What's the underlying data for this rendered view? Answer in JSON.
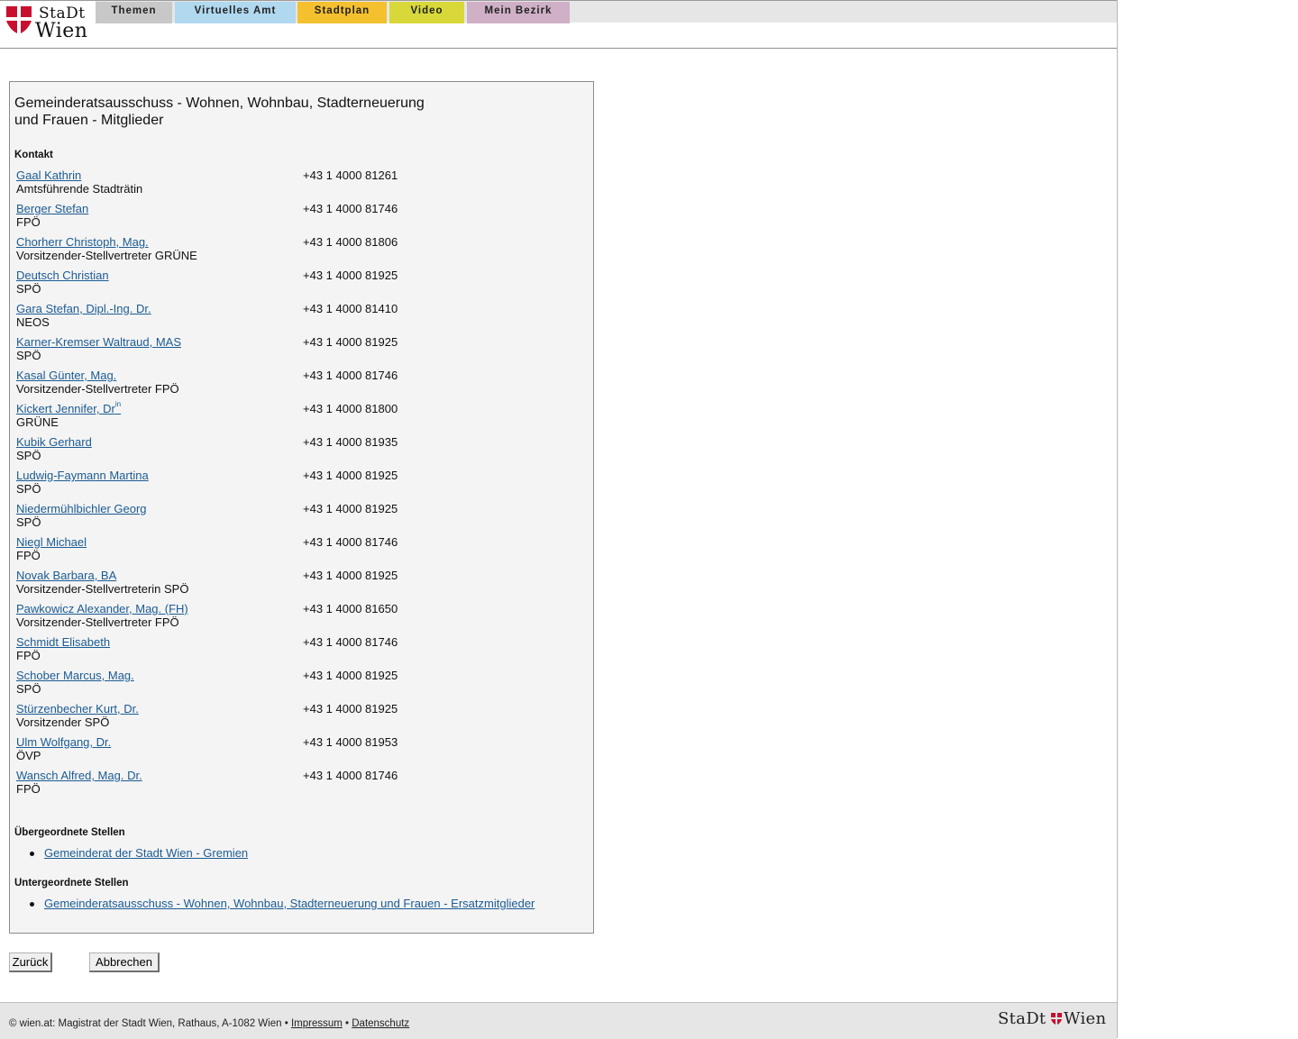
{
  "brand": {
    "logo_line1": "StaDt",
    "logo_line2": "Wien",
    "red": "#c8102e"
  },
  "nav": {
    "tabs": [
      {
        "label": "Themen",
        "color": "#c8c8c8"
      },
      {
        "label": "Virtuelles Amt",
        "color": "#b0d8ef"
      },
      {
        "label": "Stadtplan",
        "color": "#f4c02e"
      },
      {
        "label": "Video",
        "color": "#d8d83a"
      },
      {
        "label": "Mein Bezirk",
        "color": "#cfb0c6"
      }
    ]
  },
  "main": {
    "title_line1": "Gemeinderatsausschuss - Wohnen, Wohnbau, Stadterneuerung",
    "title_line2": "und Frauen - Mitglieder",
    "contact_label": "Kontakt",
    "members": [
      {
        "name": "Gaal Kathrin",
        "role": "Amtsführende Stadträtin",
        "phone": "+43 1 4000 81261"
      },
      {
        "name": "Berger Stefan",
        "role": "FPÖ",
        "phone": "+43 1 4000 81746"
      },
      {
        "name": "Chorherr Christoph, Mag.",
        "role": "Vorsitzender-Stellvertreter GRÜNE",
        "phone": "+43 1 4000 81806"
      },
      {
        "name": "Deutsch Christian",
        "role": "SPÖ",
        "phone": "+43 1 4000 81925"
      },
      {
        "name": "Gara Stefan, Dipl.-Ing. Dr.",
        "role": "NEOS",
        "phone": "+43 1 4000 81410"
      },
      {
        "name": "Karner-Kremser Waltraud, MAS",
        "role": "SPÖ",
        "phone": "+43 1 4000 81925"
      },
      {
        "name": "Kasal Günter, Mag.",
        "role": "Vorsitzender-Stellvertreter FPÖ",
        "phone": "+43 1 4000 81746"
      },
      {
        "name": "Kickert Jennifer, Dr",
        "name_sup": "in",
        "role": "GRÜNE",
        "phone": "+43 1 4000 81800"
      },
      {
        "name": "Kubik Gerhard",
        "role": "SPÖ",
        "phone": "+43 1 4000 81935"
      },
      {
        "name": "Ludwig-Faymann Martina",
        "role": "SPÖ",
        "phone": "+43 1 4000 81925"
      },
      {
        "name": "Niedermühlbichler Georg",
        "role": "SPÖ",
        "phone": "+43 1 4000 81925"
      },
      {
        "name": "Niegl Michael",
        "role": "FPÖ",
        "phone": "+43 1 4000 81746"
      },
      {
        "name": "Novak Barbara, BA",
        "role": "Vorsitzender-Stellvertreterin SPÖ",
        "phone": "+43 1 4000 81925"
      },
      {
        "name": "Pawkowicz Alexander, Mag. (FH)",
        "role": "Vorsitzender-Stellvertreter FPÖ",
        "phone": "+43 1 4000 81650"
      },
      {
        "name": "Schmidt Elisabeth",
        "role": "FPÖ",
        "phone": "+43 1 4000 81746"
      },
      {
        "name": "Schober Marcus, Mag.",
        "role": "SPÖ",
        "phone": "+43 1 4000 81925"
      },
      {
        "name": "Stürzenbecher Kurt, Dr.",
        "role": "Vorsitzender SPÖ",
        "phone": "+43 1 4000 81925"
      },
      {
        "name": "Ulm Wolfgang, Dr.",
        "role": "ÖVP",
        "phone": "+43 1 4000 81953"
      },
      {
        "name": "Wansch Alfred, Mag. Dr.",
        "role": "FPÖ",
        "phone": "+43 1 4000 81746"
      }
    ],
    "parent_label": "Übergeordnete Stellen",
    "parent_links": [
      "Gemeinderat der Stadt Wien - Gremien"
    ],
    "child_label": "Untergeordnete Stellen",
    "child_links": [
      "Gemeinderatsausschuss - Wohnen, Wohnbau, Stadterneuerung und Frauen - Ersatzmitglieder"
    ]
  },
  "buttons": {
    "back": "Zurück",
    "cancel": "Abbrechen"
  },
  "footer": {
    "text": "© wien.at: Magistrat der Stadt Wien, Rathaus, A-1082 Wien •",
    "separator": "•",
    "impressum": "Impressum",
    "datenschutz": "Datenschutz",
    "logo_left": "StaDt",
    "logo_right": "Wien"
  }
}
